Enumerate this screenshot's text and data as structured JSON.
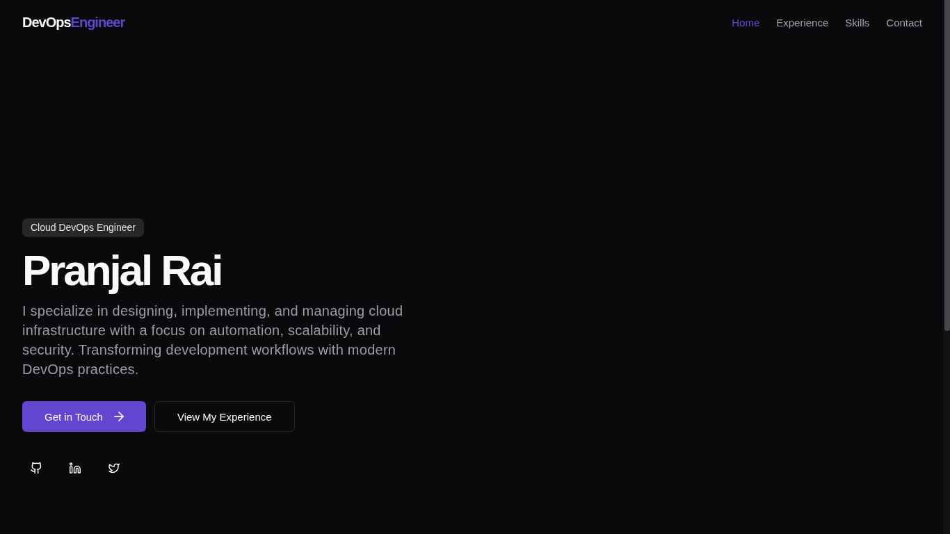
{
  "header": {
    "logo": [
      {
        "text": "DevOps",
        "kind": "plain"
      },
      {
        "text": "Engineer",
        "kind": "accent"
      }
    ],
    "nav": [
      {
        "label": "Home",
        "selected": true
      },
      {
        "label": "Experience",
        "selected": false
      },
      {
        "label": "Skills",
        "selected": false
      },
      {
        "label": "Contact",
        "selected": false
      }
    ]
  },
  "hero": {
    "badge": "Cloud DevOps Engineer",
    "name": "Pranjal Rai",
    "intro": "I specialize in designing, implementing, and managing cloud infrastructure with a focus on automation, scalability, and security. Transforming development workflows with modern DevOps practices.",
    "buttons": [
      {
        "label": "Get in Touch",
        "kind": "primary"
      },
      {
        "label": "View My Experience",
        "kind": "outline"
      }
    ],
    "social_links": [
      {
        "kind": "github"
      },
      {
        "kind": "linkedin"
      },
      {
        "kind": "twitter"
      }
    ]
  }
}
